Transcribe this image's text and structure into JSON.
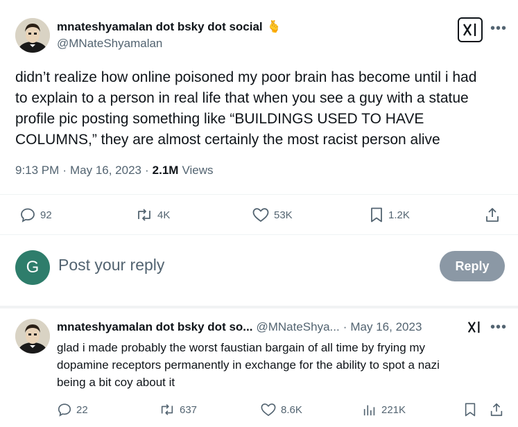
{
  "main_post": {
    "author_name": "mnateshyamalan dot bsky dot social",
    "author_badge": "🫰",
    "handle": "@MNateShyamalan",
    "text_lines": [
      "didn’t realize how online poisoned my poor brain has become until i had",
      "to explain to a person in real life that when you see a guy with a statue",
      "profile pic posting something like “BUILDINGS USED TO HAVE",
      "COLUMNS,” they are almost certainly the most racist person alive"
    ],
    "time": "9:13 PM",
    "separator": "·",
    "date": "May 16, 2023",
    "views_count": "2.1M",
    "views_label": "Views",
    "replies": "92",
    "reposts": "4K",
    "likes": "53K",
    "bookmarks": "1.2K"
  },
  "reply_composer": {
    "avatar_letter": "G",
    "placeholder": "Post your reply",
    "button_label": "Reply",
    "avatar_color": "#2e7d6b"
  },
  "reply_post": {
    "author_name": "mnateshyamalan dot bsky dot so...",
    "handle": "@MNateShya...",
    "separator": "·",
    "date": "May 16, 2023",
    "text_lines": [
      "glad i made probably the worst faustian bargain of all time by frying my",
      "dopamine receptors permanently in exchange for the ability to spot a nazi",
      "being a bit coy about it"
    ],
    "replies": "22",
    "reposts": "637",
    "likes": "8.6K",
    "views": "221K"
  },
  "icons": {
    "more": "more-icon",
    "grok": "grok-icon",
    "reply": "reply-icon",
    "repost": "repost-icon",
    "like": "like-icon",
    "bookmark": "bookmark-icon",
    "share": "share-icon",
    "views": "views-icon"
  }
}
